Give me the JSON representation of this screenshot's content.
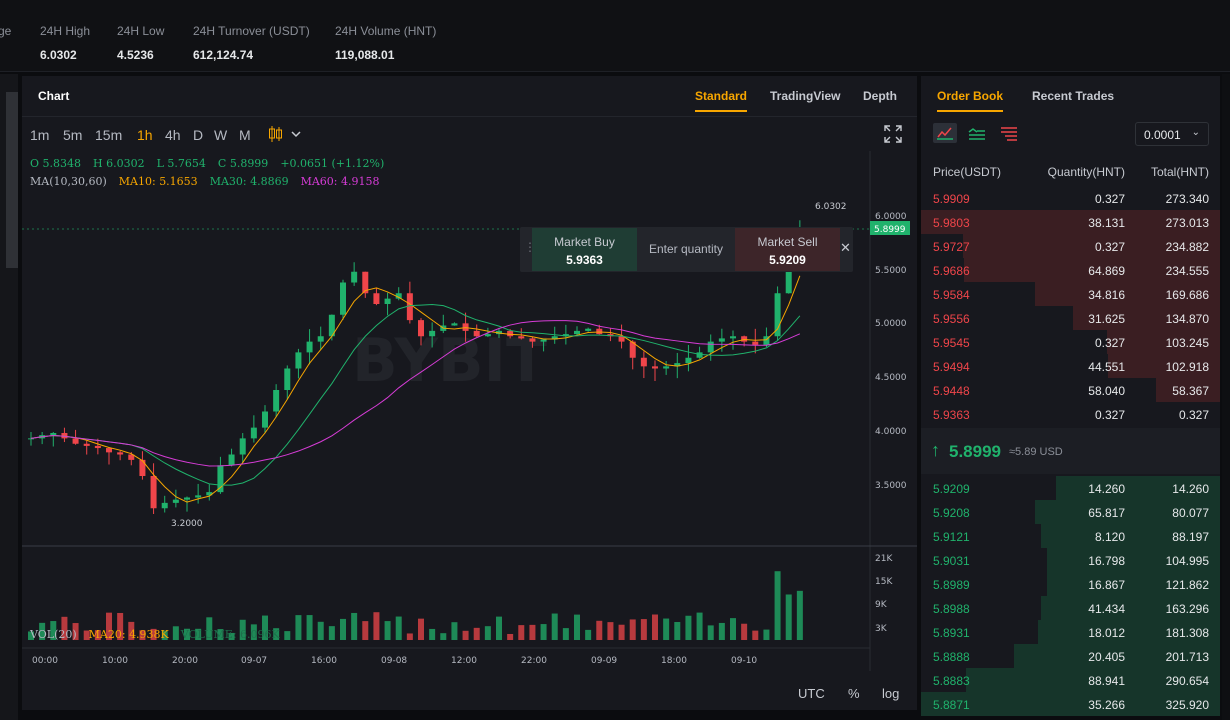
{
  "ticker": {
    "cut_label": "ge",
    "stats": [
      {
        "label": "24H High",
        "value": "6.0302"
      },
      {
        "label": "24H Low",
        "value": "4.5236"
      },
      {
        "label": "24H Turnover (USDT)",
        "value": "612,124.74"
      },
      {
        "label": "24H Volume (HNT)",
        "value": "119,088.01"
      }
    ]
  },
  "chart_panel": {
    "title": "Chart",
    "tabs": [
      "Standard",
      "TradingView",
      "Depth"
    ],
    "active_tab": "Standard",
    "timeframes": [
      "1m",
      "5m",
      "15m",
      "1h",
      "4h",
      "D",
      "W",
      "M"
    ],
    "active_timeframe": "1h",
    "ohlc": {
      "o": "O 5.8348",
      "h": "H 6.0302",
      "l": "L 5.7654",
      "c": "C 5.8999",
      "chg": "+0.0651 (+1.12%)"
    },
    "ma_label": "MA(10,30,60)",
    "ma10": "MA10: 5.1653",
    "ma30": "MA30: 4.8869",
    "ma60": "MA60: 4.9158",
    "watermark": "BYBIT",
    "quick_trade": {
      "buy_label": "Market Buy",
      "buy_price": "5.9363",
      "placeholder": "Enter quantity",
      "sell_label": "Market Sell",
      "sell_price": "5.9209"
    },
    "price_axis": [
      "6.0000",
      "5.5000",
      "5.0000",
      "4.5000",
      "4.0000",
      "3.5000"
    ],
    "last_price_tag": "5.8999",
    "high_marker": "6.0302",
    "low_marker": "3.2000",
    "vol": {
      "label": "VOL(20)",
      "ma20": "MA20: 4.938K",
      "volume": "VOLUME: 6.096K"
    },
    "vol_axis": [
      "21K",
      "15K",
      "9K",
      "3K"
    ],
    "time_axis": [
      "00:00",
      "10:00",
      "20:00",
      "09-07",
      "16:00",
      "09-08",
      "12:00",
      "22:00",
      "09-09",
      "18:00",
      "09-10"
    ],
    "bottom_controls": [
      "UTC",
      "%",
      "log"
    ]
  },
  "order_book": {
    "tabs": [
      "Order Book",
      "Recent Trades"
    ],
    "active_tab": "Order Book",
    "precision": "0.0001",
    "headers": {
      "price": "Price(USDT)",
      "qty": "Quantity(HNT)",
      "total": "Total(HNT)"
    },
    "asks": [
      {
        "price": "5.9909",
        "qty": "0.327",
        "total": "273.340",
        "depth": 0.0
      },
      {
        "price": "5.9803",
        "qty": "38.131",
        "total": "273.013",
        "depth": 1.0
      },
      {
        "price": "5.9727",
        "qty": "0.327",
        "total": "234.882",
        "depth": 0.858
      },
      {
        "price": "5.9686",
        "qty": "64.869",
        "total": "234.555",
        "depth": 0.857
      },
      {
        "price": "5.9584",
        "qty": "34.816",
        "total": "169.686",
        "depth": 0.62
      },
      {
        "price": "5.9556",
        "qty": "31.625",
        "total": "134.870",
        "depth": 0.493
      },
      {
        "price": "5.9545",
        "qty": "0.327",
        "total": "103.245",
        "depth": 0.377
      },
      {
        "price": "5.9494",
        "qty": "44.551",
        "total": "102.918",
        "depth": 0.376
      },
      {
        "price": "5.9448",
        "qty": "58.040",
        "total": "58.367",
        "depth": 0.213
      },
      {
        "price": "5.9363",
        "qty": "0.327",
        "total": "0.327",
        "depth": 0.0
      }
    ],
    "last_price": "5.8999",
    "last_price_usd": "≈5.89 USD",
    "bids": [
      {
        "price": "5.9209",
        "qty": "14.260",
        "total": "14.260",
        "depth": 0.55
      },
      {
        "price": "5.9208",
        "qty": "65.817",
        "total": "80.077",
        "depth": 0.62
      },
      {
        "price": "5.9121",
        "qty": "8.120",
        "total": "88.197",
        "depth": 0.6
      },
      {
        "price": "5.9031",
        "qty": "16.798",
        "total": "104.995",
        "depth": 0.58
      },
      {
        "price": "5.8989",
        "qty": "16.867",
        "total": "121.862",
        "depth": 0.58
      },
      {
        "price": "5.8988",
        "qty": "41.434",
        "total": "163.296",
        "depth": 0.6
      },
      {
        "price": "5.8931",
        "qty": "18.012",
        "total": "181.308",
        "depth": 0.61
      },
      {
        "price": "5.8888",
        "qty": "20.405",
        "total": "201.713",
        "depth": 0.69
      },
      {
        "price": "5.8883",
        "qty": "88.941",
        "total": "290.654",
        "depth": 0.85
      },
      {
        "price": "5.8871",
        "qty": "35.266",
        "total": "325.920",
        "depth": 1.0
      }
    ]
  },
  "colors": {
    "accent": "#f7a600",
    "up": "#20b26c",
    "down": "#ef454a",
    "ma10": "#f7a600",
    "ma30": "#20b26c",
    "ma60": "#d63cd6"
  }
}
